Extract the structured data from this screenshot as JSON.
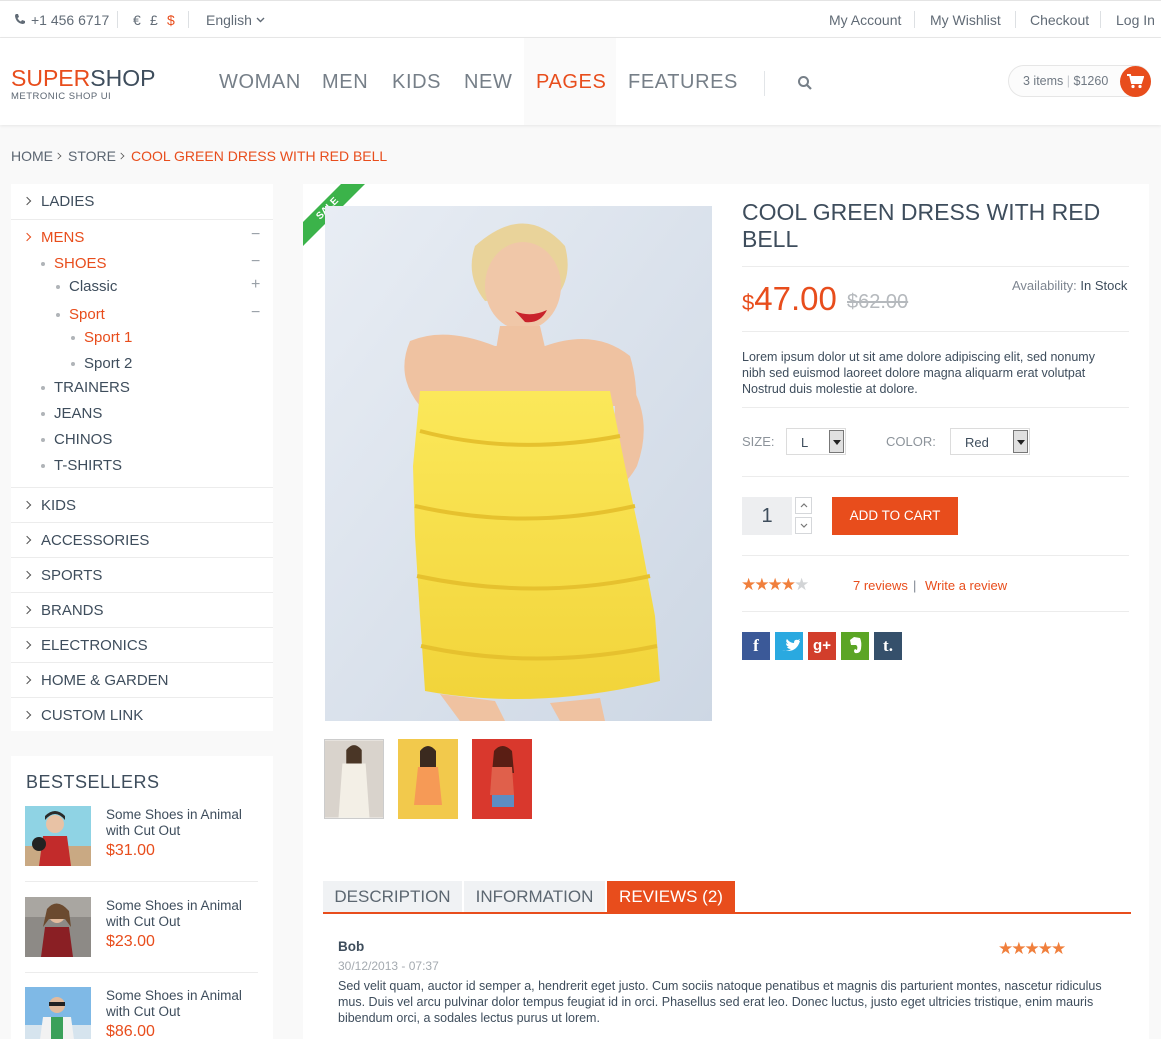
{
  "topbar": {
    "phone": "+1 456 6717",
    "currencies": [
      "€",
      "£",
      "$"
    ],
    "language": "English",
    "links": [
      "My Account",
      "My Wishlist",
      "Checkout",
      "Log In"
    ]
  },
  "header": {
    "logo_part1": "SUPER",
    "logo_part2": "SHOP",
    "logo_sub": "METRONIC SHOP UI",
    "nav": [
      "WOMAN",
      "MEN",
      "KIDS",
      "NEW",
      "PAGES",
      "FEATURES"
    ],
    "active_nav": "PAGES",
    "cart_items": "3 items",
    "cart_total": "$1260"
  },
  "breadcrumb": [
    "HOME",
    "STORE",
    "COOL GREEN DRESS WITH RED BELL"
  ],
  "sidebar": {
    "top_items": [
      "LADIES",
      "MENS"
    ],
    "mens_sub": [
      "SHOES",
      "TRAINERS",
      "JEANS",
      "CHINOS",
      "T-SHIRTS"
    ],
    "shoes_sub": [
      "Classic",
      "Sport"
    ],
    "sport_sub": [
      "Sport 1",
      "Sport 2"
    ],
    "bottom_items": [
      "KIDS",
      "ACCESSORIES",
      "SPORTS",
      "BRANDS",
      "ELECTRONICS",
      "HOME & GARDEN",
      "CUSTOM LINK"
    ]
  },
  "bestsellers": {
    "title": "BESTSELLERS",
    "items": [
      {
        "name": "Some Shoes in Animal with Cut Out",
        "price": "$31.00"
      },
      {
        "name": "Some Shoes in Animal with Cut Out",
        "price": "$23.00"
      },
      {
        "name": "Some Shoes in Animal with Cut Out",
        "price": "$86.00"
      }
    ]
  },
  "product": {
    "sale_badge": "SALE",
    "title": "COOL GREEN DRESS WITH RED BELL",
    "currency": "$",
    "price": "47.00",
    "old_price": "$62.00",
    "availability_label": "Availability:",
    "availability": "In Stock",
    "description": "Lorem ipsum dolor ut sit ame dolore adipiscing elit, sed nonumy nibh sed euismod laoreet dolore magna aliquarm erat volutpat Nostrud duis molestie at dolore.",
    "size_label": "SIZE:",
    "size_value": "L",
    "color_label": "COLOR:",
    "color_value": "Red",
    "quantity": "1",
    "add_to_cart": "ADD TO CART",
    "rating": 4,
    "reviews_link": "7 reviews",
    "reviews_sep": "|",
    "write_review": "Write a review",
    "social": [
      "f",
      "t",
      "g+",
      "e",
      "t."
    ]
  },
  "tabs": [
    "DESCRIPTION",
    "INFORMATION",
    "REVIEWS (2)"
  ],
  "active_tab": "REVIEWS (2)",
  "review": {
    "author": "Bob",
    "date": "30/12/2013 - 07:37",
    "rating": 5,
    "text": "Sed velit quam, auctor id semper a, hendrerit eget justo. Cum sociis natoque penatibus et magnis dis parturient montes, nascetur ridiculus mus. Duis vel arcu pulvinar dolor tempus feugiat id in orci. Phasellus sed erat leo. Donec luctus, justo eget ultricies tristique, enim mauris bibendum orci, a sodales lectus purus ut lorem."
  },
  "colors": {
    "accent": "#e84d1c",
    "text": "#3e4d5c"
  }
}
